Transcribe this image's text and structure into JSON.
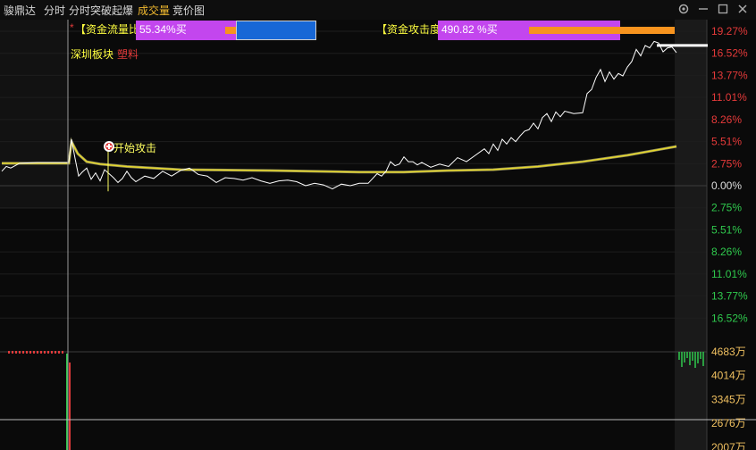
{
  "tabs": {
    "stock": "骏鼎达",
    "intraday": "分时",
    "breakout": "分时突破起爆",
    "volume": "成交量",
    "auction": "竞价图"
  },
  "icons": [
    "settings-icon",
    "minus-icon",
    "restore-icon",
    "close-icon"
  ],
  "indicators": {
    "flow_prefix": "*",
    "flow_label": "【资金流量比】",
    "flow_value": "55.34%买",
    "attack_label": "【资金攻击度】",
    "attack_value": "490.82 %买",
    "sector": "深圳板块",
    "sector_tag": "塑料",
    "signal": "开始攻击"
  },
  "colors": {
    "background": "#0a0a0a",
    "price_line": "#ffffff",
    "avg_line": "#e6e05a",
    "up": "#e63a3a",
    "down": "#2fc94d",
    "axis_text_volume": "#f0c060",
    "magenta": "#c346ee",
    "blue": "#1767d6",
    "orange": "#f7931e"
  },
  "price_axis": {
    "up": [
      "19.27%",
      "16.52%",
      "13.77%",
      "11.01%",
      "8.26%",
      "5.51%",
      "2.75%"
    ],
    "zero": "0.00%",
    "down": [
      "2.75%",
      "5.51%",
      "8.26%",
      "11.01%",
      "13.77%",
      "16.52%"
    ]
  },
  "volume_axis": [
    "4683万",
    "4014万",
    "3345万",
    "2676万",
    "2007万"
  ],
  "chart_data": {
    "type": "line",
    "yunit": "%",
    "ylim": [
      -19.27,
      19.27
    ],
    "price": [
      [
        0,
        1.8
      ],
      [
        5,
        2.4
      ],
      [
        10,
        2.2
      ],
      [
        20,
        2.8
      ],
      [
        40,
        2.9
      ],
      [
        60,
        2.9
      ],
      [
        75,
        2.9
      ],
      [
        78,
        5.8
      ],
      [
        82,
        3.4
      ],
      [
        86,
        1.2
      ],
      [
        90,
        1.7
      ],
      [
        95,
        2.2
      ],
      [
        100,
        0.8
      ],
      [
        105,
        1.6
      ],
      [
        110,
        0.6
      ],
      [
        115,
        2.0
      ],
      [
        120,
        1.5
      ],
      [
        125,
        1.0
      ],
      [
        130,
        0.4
      ],
      [
        135,
        0.9
      ],
      [
        140,
        1.8
      ],
      [
        145,
        1.0
      ],
      [
        150,
        0.5
      ],
      [
        160,
        1.2
      ],
      [
        170,
        0.9
      ],
      [
        180,
        1.8
      ],
      [
        190,
        1.2
      ],
      [
        200,
        1.9
      ],
      [
        210,
        2.2
      ],
      [
        220,
        1.4
      ],
      [
        230,
        1.2
      ],
      [
        240,
        0.4
      ],
      [
        250,
        1.0
      ],
      [
        260,
        0.9
      ],
      [
        270,
        0.7
      ],
      [
        280,
        1.0
      ],
      [
        290,
        0.6
      ],
      [
        300,
        0.3
      ],
      [
        310,
        0.6
      ],
      [
        320,
        0.7
      ],
      [
        330,
        0.5
      ],
      [
        340,
        0.0
      ],
      [
        350,
        0.3
      ],
      [
        360,
        0.1
      ],
      [
        370,
        -0.4
      ],
      [
        380,
        0.2
      ],
      [
        390,
        0.0
      ],
      [
        400,
        0.3
      ],
      [
        410,
        0.3
      ],
      [
        415,
        0.9
      ],
      [
        420,
        1.5
      ],
      [
        425,
        1.2
      ],
      [
        430,
        1.8
      ],
      [
        435,
        3.0
      ],
      [
        440,
        2.5
      ],
      [
        445,
        2.7
      ],
      [
        450,
        3.6
      ],
      [
        455,
        3.0
      ],
      [
        460,
        3.0
      ],
      [
        465,
        2.6
      ],
      [
        470,
        2.9
      ],
      [
        480,
        2.3
      ],
      [
        490,
        2.7
      ],
      [
        500,
        2.4
      ],
      [
        510,
        3.5
      ],
      [
        520,
        3.0
      ],
      [
        530,
        3.8
      ],
      [
        540,
        4.6
      ],
      [
        545,
        4.0
      ],
      [
        550,
        5.2
      ],
      [
        555,
        4.4
      ],
      [
        560,
        5.8
      ],
      [
        565,
        5.2
      ],
      [
        570,
        6.0
      ],
      [
        575,
        5.5
      ],
      [
        580,
        6.2
      ],
      [
        585,
        6.8
      ],
      [
        590,
        7.0
      ],
      [
        595,
        7.8
      ],
      [
        600,
        7.1
      ],
      [
        605,
        8.5
      ],
      [
        610,
        9.0
      ],
      [
        615,
        8.0
      ],
      [
        620,
        9.2
      ],
      [
        625,
        8.6
      ],
      [
        630,
        9.3
      ],
      [
        640,
        9.0
      ],
      [
        650,
        9.1
      ],
      [
        655,
        11.5
      ],
      [
        660,
        12.0
      ],
      [
        665,
        13.5
      ],
      [
        670,
        14.5
      ],
      [
        675,
        13.0
      ],
      [
        680,
        14.2
      ],
      [
        685,
        13.3
      ],
      [
        690,
        14.0
      ],
      [
        695,
        13.7
      ],
      [
        700,
        14.8
      ],
      [
        705,
        15.5
      ],
      [
        710,
        17.0
      ],
      [
        715,
        16.2
      ],
      [
        720,
        17.5
      ],
      [
        725,
        17.2
      ],
      [
        730,
        18.0
      ],
      [
        735,
        17.8
      ],
      [
        740,
        16.7
      ],
      [
        745,
        17.2
      ],
      [
        750,
        17.3
      ],
      [
        755,
        16.6
      ]
    ],
    "avg": [
      [
        0,
        2.8
      ],
      [
        75,
        2.8
      ],
      [
        78,
        5.5
      ],
      [
        85,
        4.0
      ],
      [
        95,
        3.0
      ],
      [
        110,
        2.7
      ],
      [
        140,
        2.4
      ],
      [
        200,
        2.0
      ],
      [
        300,
        1.9
      ],
      [
        400,
        1.7
      ],
      [
        450,
        1.7
      ],
      [
        500,
        1.9
      ],
      [
        550,
        2.0
      ],
      [
        600,
        2.4
      ],
      [
        650,
        3.0
      ],
      [
        700,
        3.8
      ],
      [
        740,
        4.6
      ],
      [
        755,
        4.9
      ]
    ]
  }
}
